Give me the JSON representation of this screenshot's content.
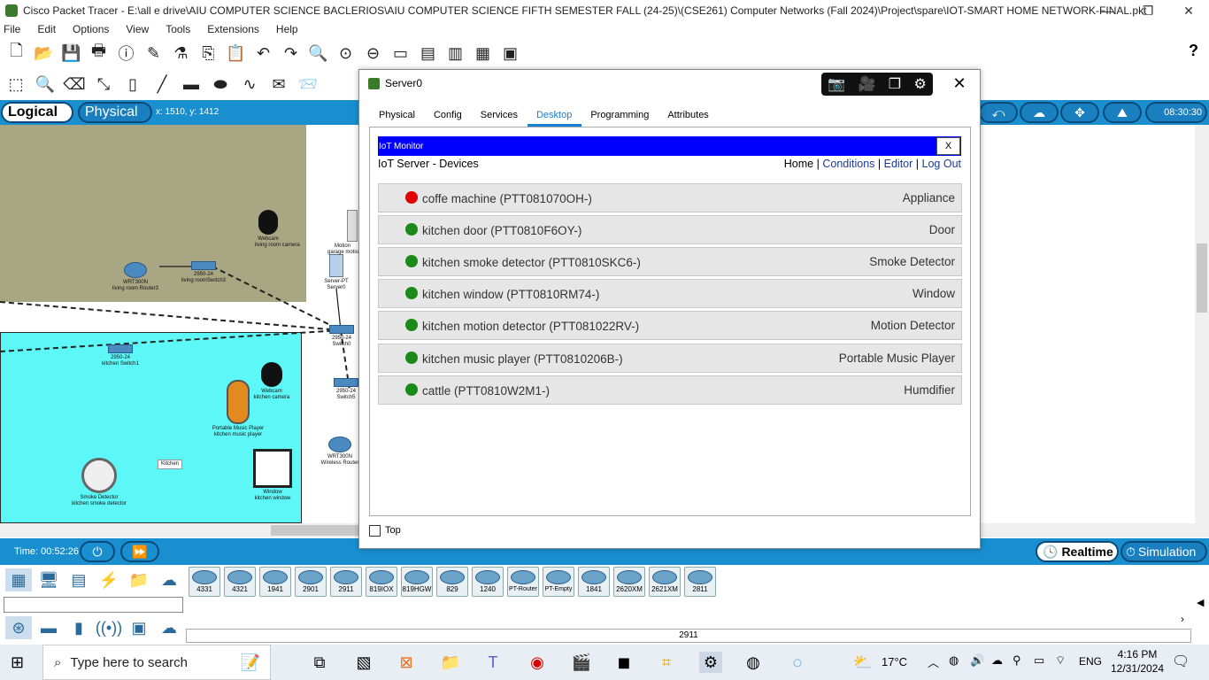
{
  "window": {
    "title": "Cisco Packet Tracer - E:\\all e drive\\AIU COMPUTER SCIENCE BACLERIOS\\AIU COMPUTER SCIENCE FIFTH SEMESTER FALL (24-25)\\(CSE261) Computer Networks (Fall 2024)\\Project\\spare\\IOT-SMART HOME NETWORK-FINAL.pkt",
    "minimize": "—",
    "restore": "❐",
    "close": "✕"
  },
  "menu": [
    "File",
    "Edit",
    "Options",
    "View",
    "Tools",
    "Extensions",
    "Help"
  ],
  "help_label": "?",
  "modebar": {
    "logical": "Logical",
    "physical": "Physical",
    "coords": "x: 1510, y: 1412",
    "clock": "08:30:30"
  },
  "workspace_labels": {
    "webcam_lr": "Webcam\nliving room camera",
    "router_lr": "WRT300N\nliving room Router3",
    "switch_lr": "2950-24\nliving roomSwitch3",
    "server": "Server-PT\nServer0",
    "motion_garage": "Motion\ngarage motion",
    "switch0": "2950-24\nSwitch0",
    "switch_kitchen": "2950-24\nkitchen Switch1",
    "webcam_kitchen": "Webcam\nkitchen camera",
    "switch5": "2950-24\nSwitch5",
    "music": "Portable Music Player\nkitchen music player",
    "router_wireless": "WRT300N\nWireless Router",
    "kitchen_label": "Kitchen",
    "smoke": "Smoke Detector\nkitchen smoke detector",
    "window": "Window\nkitchen window"
  },
  "status": {
    "time": "Time: 00:52:26",
    "realtime": "Realtime",
    "simulation": "Simulation"
  },
  "device_models": [
    "4331",
    "4321",
    "1941",
    "2901",
    "2911",
    "819IOX",
    "819HGW",
    "829",
    "1240",
    "PT-Router",
    "PT-Empty",
    "1841",
    "2620XM",
    "2621XM",
    "2811"
  ],
  "selected_model": "2911",
  "taskbar": {
    "search_placeholder": "Type here to search",
    "weather": "17°C",
    "lang": "ENG",
    "time": "4:16 PM",
    "date": "12/31/2024"
  },
  "dialog": {
    "title": "Server0",
    "close": "✕",
    "tabs": [
      "Physical",
      "Config",
      "Services",
      "Desktop",
      "Programming",
      "Attributes"
    ],
    "active_tab": "Desktop",
    "iot": {
      "window_title": "IoT Monitor",
      "close": "X",
      "heading": "IoT Server - Devices",
      "nav": {
        "home": "Home",
        "conditions": "Conditions",
        "editor": "Editor",
        "logout": "Log Out",
        "sep": "|"
      },
      "devices": [
        {
          "name": "coffe machine (PTT081070OH-)",
          "type": "Appliance",
          "status_color": "#e00000"
        },
        {
          "name": "kitchen door (PTT0810F6OY-)",
          "type": "Door",
          "status_color": "#1a8a1a"
        },
        {
          "name": "kitchen smoke detector (PTT0810SKC6-)",
          "type": "Smoke Detector",
          "status_color": "#1a8a1a"
        },
        {
          "name": "kitchen window (PTT0810RM74-)",
          "type": "Window",
          "status_color": "#1a8a1a"
        },
        {
          "name": "kitchen motion detector (PTT081022RV-)",
          "type": "Motion Detector",
          "status_color": "#1a8a1a"
        },
        {
          "name": "kitchen music player (PTT0810206B-)",
          "type": "Portable Music Player",
          "status_color": "#1a8a1a"
        },
        {
          "name": "cattle (PTT0810W2M1-)",
          "type": "Humdifier",
          "status_color": "#1a8a1a"
        }
      ]
    },
    "top_label": "Top"
  }
}
